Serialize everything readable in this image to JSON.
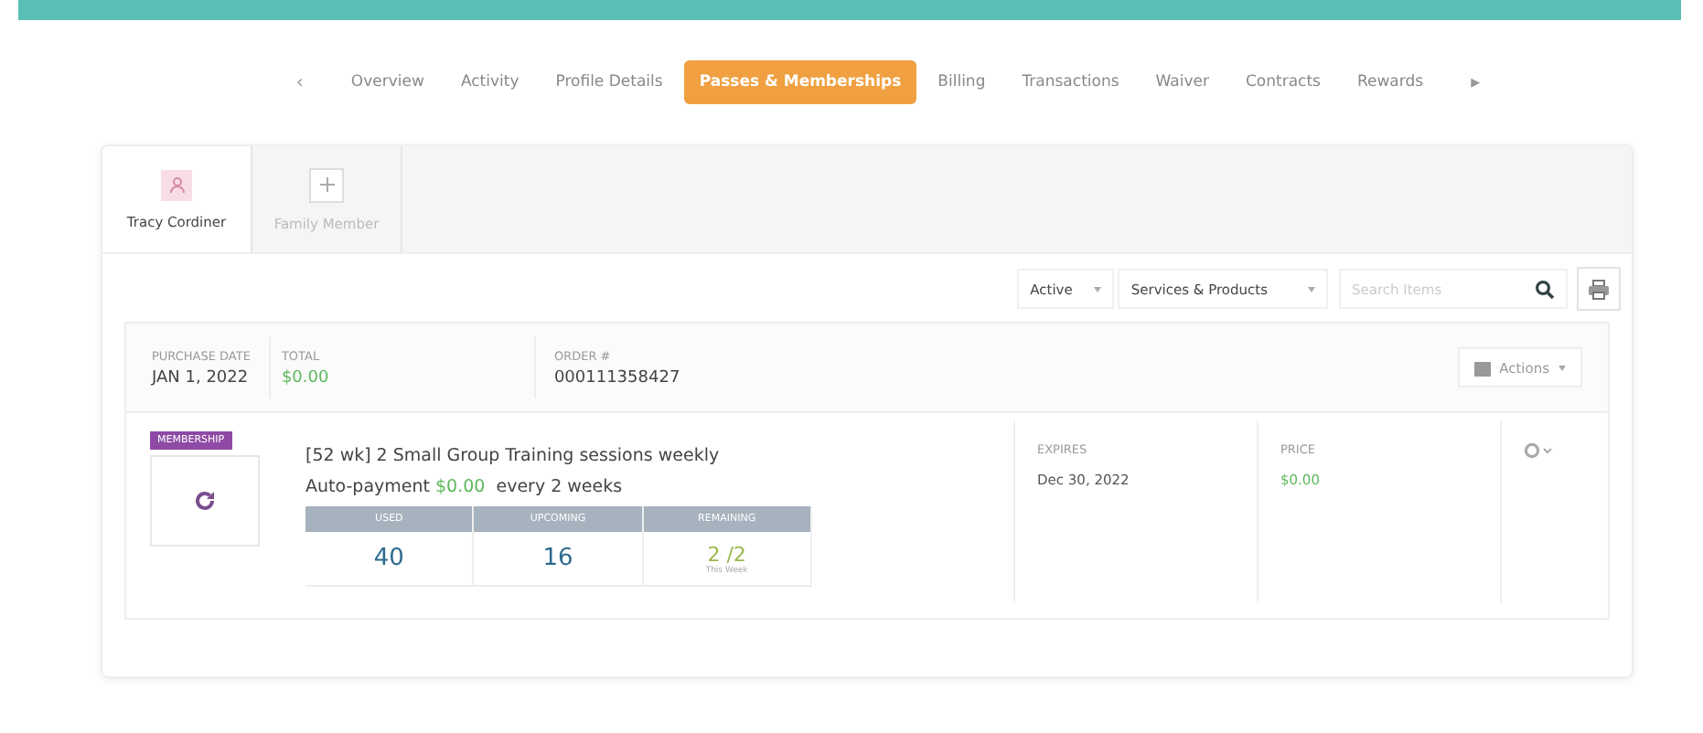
{
  "nav_tabs": [
    {
      "label": "‹",
      "kind": "arrow",
      "selected": false
    },
    {
      "label": "Overview",
      "kind": "tab",
      "selected": false
    },
    {
      "label": "Activity",
      "kind": "tab",
      "selected": false
    },
    {
      "label": "Profile Details",
      "kind": "tab",
      "selected": false
    },
    {
      "label": "Passes & Memberships",
      "kind": "tab",
      "selected": true
    },
    {
      "label": "Billing",
      "kind": "tab",
      "selected": false
    },
    {
      "label": "Transactions",
      "kind": "tab",
      "selected": false
    },
    {
      "label": "Waiver",
      "kind": "tab",
      "selected": false
    },
    {
      "label": "Contracts",
      "kind": "tab",
      "selected": false
    },
    {
      "label": "Rewards",
      "kind": "tab",
      "selected": false
    },
    {
      "label": "▸",
      "kind": "arrow",
      "selected": false
    }
  ],
  "members": [
    {
      "name": "Tracy Cordiner",
      "kind": "person",
      "selected": true
    },
    {
      "name": "Family Member",
      "kind": "add",
      "selected": false
    }
  ],
  "filters": {
    "status": "Active",
    "category": "Services & Products",
    "search": {
      "placeholder": "Search Items"
    }
  },
  "order": {
    "purchase_date_label": "PURCHASE DATE",
    "purchase_date": "JAN 1, 2022",
    "total_label": "TOTAL",
    "total": "$0.00",
    "order_label": "ORDER #",
    "order_number": "000111358427",
    "actions": "Actions",
    "item": {
      "badge": "MEMBERSHIP",
      "title": "[52 wk] 2 Small Group Training sessions weekly",
      "payment_prefix": "Auto-payment",
      "payment_amount": "$0.00",
      "payment_suffix": "every 2 weeks",
      "usage": [
        {
          "heading": "USED",
          "value": "40"
        },
        {
          "heading": "UPCOMING",
          "value": "16"
        },
        {
          "heading": "REMAINING",
          "value": "2 /2",
          "note": "This Week"
        }
      ],
      "expires_label": "EXPIRES",
      "expires": "Dec 30, 2022",
      "price_label": "PRICE",
      "price": "$0.00"
    }
  }
}
